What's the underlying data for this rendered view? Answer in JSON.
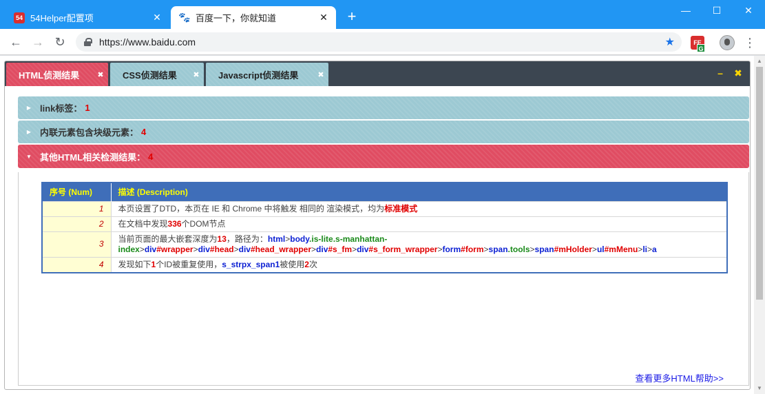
{
  "browser": {
    "tabs": [
      {
        "label": "54Helper配置项",
        "favicon": "54"
      },
      {
        "label": "百度一下，你就知道",
        "favicon": "🐾"
      }
    ],
    "new_tab": "+",
    "window_controls": [
      "—",
      "☐",
      "✕"
    ],
    "url": "https://www.baidu.com",
    "extension_badge": "G"
  },
  "panel": {
    "tabs": [
      {
        "label": "HTML侦测结果",
        "close": "✖"
      },
      {
        "label": "CSS侦测结果",
        "close": "✖"
      },
      {
        "label": "Javascript侦测结果",
        "close": "✖"
      }
    ],
    "minimize": "–",
    "close": "✖"
  },
  "accordion": [
    {
      "label": "link标签：",
      "count": "1"
    },
    {
      "label": "内联元素包含块级元素：",
      "count": "4"
    },
    {
      "label": "其他HTML相关检测结果：",
      "count": "4"
    }
  ],
  "table": {
    "headers": [
      "序号 (Num)",
      "描述 (Description)"
    ],
    "rows": [
      {
        "num": "1",
        "parts": [
          {
            "t": "本页设置了DTD，本页在 IE 和 Chrome 中将触发 相同的 渲染模式，均为",
            "c": ""
          },
          {
            "t": "标准模式",
            "c": "red"
          }
        ]
      },
      {
        "num": "2",
        "parts": [
          {
            "t": "在文档中发现",
            "c": ""
          },
          {
            "t": "336",
            "c": "red"
          },
          {
            "t": "个DOM节点",
            "c": ""
          }
        ]
      },
      {
        "num": "3",
        "parts": [
          {
            "t": "当前页面的最大嵌套深度为",
            "c": ""
          },
          {
            "t": "13",
            "c": "red"
          },
          {
            "t": "，路径为：",
            "c": ""
          },
          {
            "t": "html",
            "c": "blue"
          },
          {
            "t": ">",
            "c": ""
          },
          {
            "t": "body",
            "c": "blue"
          },
          {
            "t": ".is-lite.s-manhattan-index",
            "c": "green"
          },
          {
            "t": ">",
            "c": ""
          },
          {
            "t": "div",
            "c": "blue"
          },
          {
            "t": "#wrapper",
            "c": "red"
          },
          {
            "t": ">",
            "c": ""
          },
          {
            "t": "div",
            "c": "blue"
          },
          {
            "t": "#head",
            "c": "red"
          },
          {
            "t": ">",
            "c": ""
          },
          {
            "t": "div",
            "c": "blue"
          },
          {
            "t": "#head_wrapper",
            "c": "red"
          },
          {
            "t": ">",
            "c": ""
          },
          {
            "t": "div",
            "c": "blue"
          },
          {
            "t": "#s_fm",
            "c": "red"
          },
          {
            "t": ">",
            "c": ""
          },
          {
            "t": "div",
            "c": "blue"
          },
          {
            "t": "#s_form_wrapper",
            "c": "red"
          },
          {
            "t": ">",
            "c": ""
          },
          {
            "t": "form",
            "c": "blue"
          },
          {
            "t": "#form",
            "c": "red"
          },
          {
            "t": ">",
            "c": ""
          },
          {
            "t": "span",
            "c": "blue"
          },
          {
            "t": ".tools",
            "c": "green"
          },
          {
            "t": ">",
            "c": ""
          },
          {
            "t": "span",
            "c": "blue"
          },
          {
            "t": "#mHolder",
            "c": "red"
          },
          {
            "t": ">",
            "c": ""
          },
          {
            "t": "ul",
            "c": "blue"
          },
          {
            "t": "#mMenu",
            "c": "red"
          },
          {
            "t": ">",
            "c": ""
          },
          {
            "t": "li",
            "c": "blue"
          },
          {
            "t": ">",
            "c": ""
          },
          {
            "t": "a",
            "c": "blue"
          }
        ]
      },
      {
        "num": "4",
        "parts": [
          {
            "t": "发现如下",
            "c": ""
          },
          {
            "t": "1",
            "c": "red"
          },
          {
            "t": "个ID被重复使用，",
            "c": ""
          },
          {
            "t": "s_strpx_span1",
            "c": "blue"
          },
          {
            "t": "被使用",
            "c": ""
          },
          {
            "t": "2",
            "c": "red"
          },
          {
            "t": "次",
            "c": ""
          }
        ]
      }
    ]
  },
  "help_link": "查看更多HTML帮助>>",
  "colors": {
    "chrome_blue": "#2196f3",
    "panel_dark": "#3c4651",
    "tab_active": "#e04c62",
    "tab_inactive": "#9cc9d3",
    "table_header": "#3f6eb9",
    "header_text": "#ffff00"
  }
}
